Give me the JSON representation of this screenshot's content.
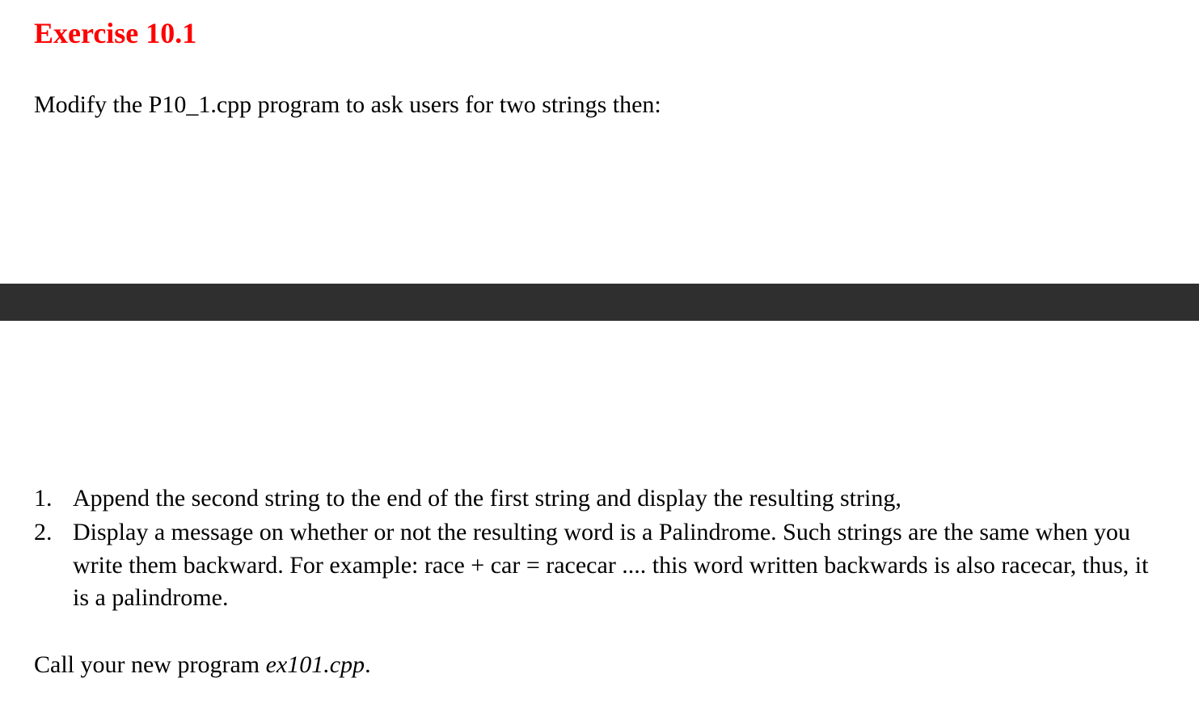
{
  "title": "Exercise 10.1",
  "intro": "Modify the P10_1.cpp program to ask users for two strings then:",
  "items": [
    "Append the second string to the end of the first string and display the resulting string,",
    "Display a message on whether or not the resulting word is a Palindrome. Such strings are the same when you write them backward. For example:  race + car = racecar .... this word written backwards is also racecar, thus, it is a palindrome."
  ],
  "closing_prefix": "Call your new program ",
  "closing_filename": "ex101.cpp",
  "closing_suffix": "."
}
